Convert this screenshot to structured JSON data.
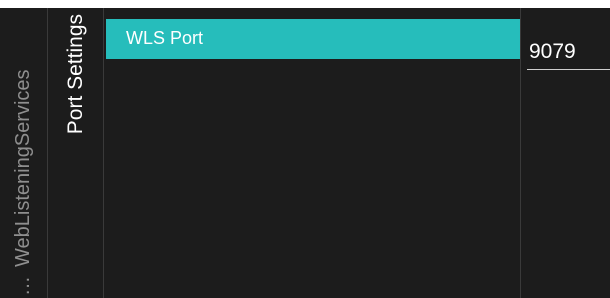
{
  "breadcrumb": {
    "ellipsis": "…",
    "parent_label": "WebListeningServices"
  },
  "page": {
    "title": "Port Settings"
  },
  "menu": {
    "items": [
      {
        "label": "WLS Port",
        "selected": true
      }
    ]
  },
  "value_panel": {
    "value": "9079"
  },
  "colors": {
    "background": "#1c1c1c",
    "selection": "#26bdbb",
    "text_primary": "#ffffff",
    "text_secondary": "#8f8f8f"
  }
}
